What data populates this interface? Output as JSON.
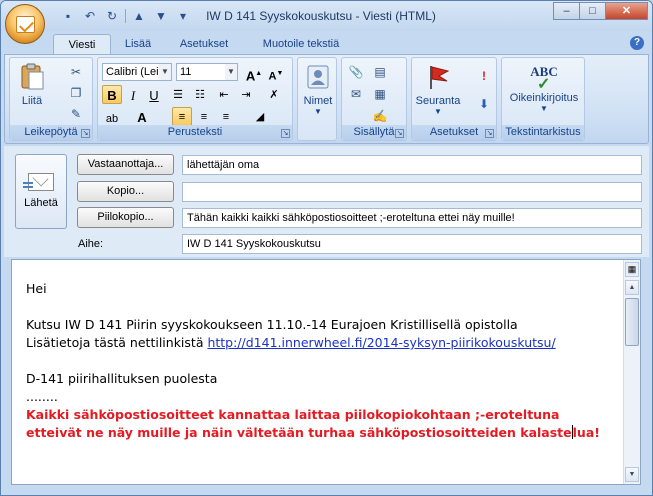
{
  "window": {
    "title": "IW D 141 Syyskokouskutsu - Viesti (HTML)",
    "controls": {
      "minimize": "–",
      "maximize": "□",
      "close": "✕"
    }
  },
  "quick_access": [
    "save-icon",
    "undo-icon",
    "redo-icon",
    "up-icon",
    "down-icon",
    "customize-icon"
  ],
  "tabs": [
    {
      "label": "Viesti",
      "active": true
    },
    {
      "label": "Lisää",
      "active": false
    },
    {
      "label": "Asetukset",
      "active": false
    },
    {
      "label": "Muotoile tekstiä",
      "active": false
    }
  ],
  "help_label": "?",
  "ribbon": {
    "clipboard": {
      "group_label": "Leikepöytä",
      "paste_label": "Liitä"
    },
    "basic_text": {
      "group_label": "Perusteksti",
      "font_name": "Calibri (Leip",
      "font_size": "11",
      "bold": "B",
      "italic": "I",
      "underline": "U"
    },
    "names": {
      "label": "Nimet"
    },
    "include": {
      "group_label": "Sisällytä"
    },
    "options": {
      "group_label": "Asetukset",
      "follow_up_label": "Seuranta"
    },
    "proofing": {
      "group_label": "Tekstintarkistus",
      "spelling_label": "Oikeinkirjoitus",
      "abc": "ABC"
    }
  },
  "form": {
    "send_label": "Lähetä",
    "to_button": "Vastaanottaja...",
    "cc_button": "Kopio...",
    "bcc_button": "Piilokopio...",
    "subject_label": "Aihe:",
    "to_value": "lähettäjän oma",
    "cc_value": "",
    "bcc_value": "Tähän kaikki kaikki sähköpostiosoitteet ;-eroteltuna ettei näy muille!",
    "subject_value": "IW D 141 Syyskokouskutsu"
  },
  "message": {
    "greeting": "Hei",
    "line1": "Kutsu IW D 141 Piirin syyskokoukseen 11.10.-14 Eurajoen Kristillisellä opistolla",
    "line2_prefix": "Lisätietoja tästä nettilinkistä ",
    "link": "http://d141.innerwheel.fi/2014-syksyn-piirikokouskutsu/",
    "signature": "D-141 piirihallituksen puolesta",
    "dots": "........",
    "warning_before_caret": "Kaikki sähköpostiosoitteet kannattaa laittaa piilokopiokohtaan ;-eroteltuna etteivät ne näy muille ja näin vältetään turhaa sähköpostiosoitteiden kalaste",
    "warning_after_caret": "lua!"
  },
  "colors": {
    "ribbon_text": "#15428b",
    "link": "#1a32c8",
    "warning": "#e31b23"
  }
}
